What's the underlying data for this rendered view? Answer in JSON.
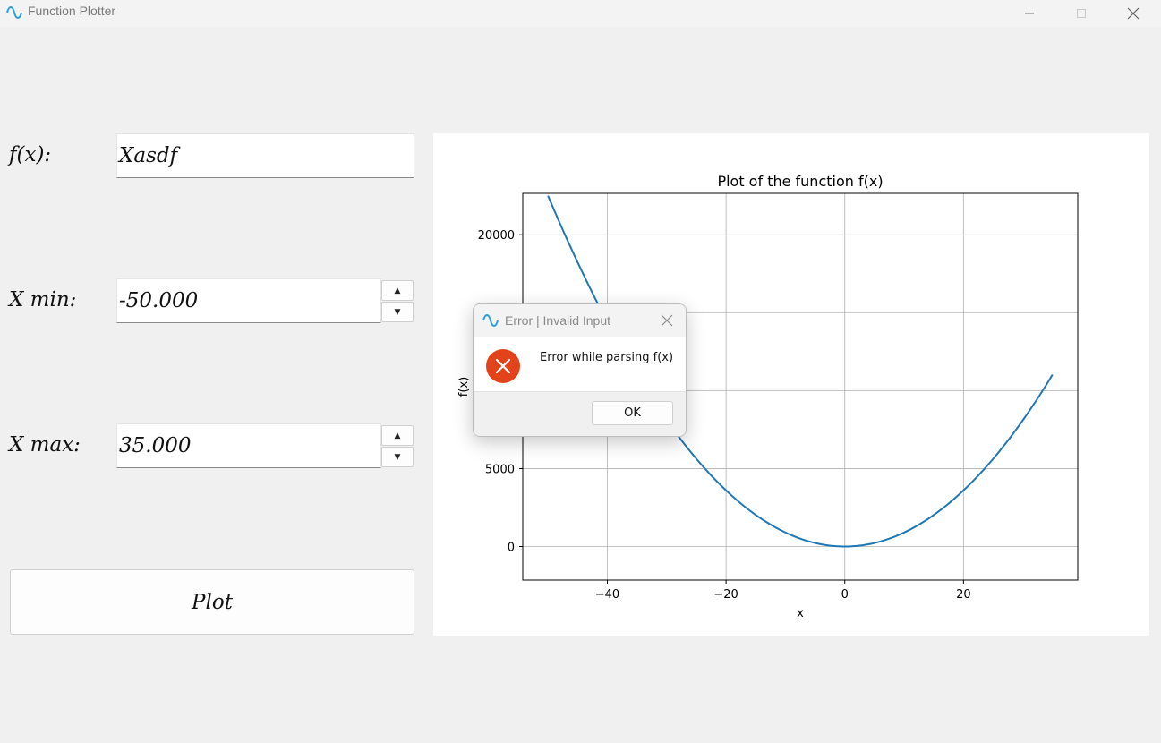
{
  "window": {
    "title": "Function Plotter",
    "controls": [
      "minimize-icon",
      "maximize-icon",
      "close-icon"
    ]
  },
  "form": {
    "fx_label": "f(x):",
    "fx_value": "Xasdf",
    "xmin_label": "X min:",
    "xmin_value": "-50.000",
    "xmax_label": "X max:",
    "xmax_value": "35.000",
    "plot_label": "Plot"
  },
  "chart_data": {
    "type": "line",
    "title": "Plot of the function f(x)",
    "xlabel": "x",
    "ylabel": "f(x)",
    "xlim": [
      -54.25,
      39.25
    ],
    "ylim": [
      -2154,
      22654
    ],
    "x_ticks": [
      -40,
      -20,
      0,
      20
    ],
    "x_tick_labels": [
      "−40",
      "−20",
      "0",
      "20"
    ],
    "y_ticks": [
      0,
      5000,
      20000
    ],
    "y_tick_labels": [
      "0",
      "5000",
      "20000"
    ],
    "grid": true,
    "series": [
      {
        "function": "9*x^2",
        "x_range": [
          -50,
          35
        ],
        "color": "#1f77b4"
      }
    ]
  },
  "dialog": {
    "title": "Error | Invalid Input",
    "message": "Error while parsing f(x)",
    "ok_label": "OK",
    "icon": "error-icon"
  },
  "colors": {
    "accent_line": "#1f77b4",
    "error_icon": "#e2431a",
    "app_icon": "#2d9fd8"
  }
}
